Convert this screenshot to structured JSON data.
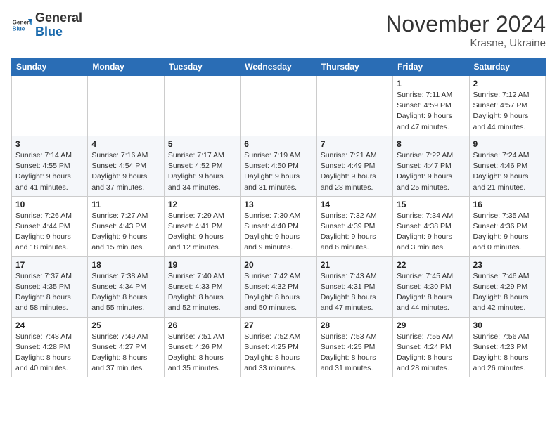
{
  "header": {
    "logo_general": "General",
    "logo_blue": "Blue",
    "month_title": "November 2024",
    "location": "Krasne, Ukraine"
  },
  "days_of_week": [
    "Sunday",
    "Monday",
    "Tuesday",
    "Wednesday",
    "Thursday",
    "Friday",
    "Saturday"
  ],
  "weeks": [
    [
      {
        "day": "",
        "sunrise": "",
        "sunset": "",
        "daylight": ""
      },
      {
        "day": "",
        "sunrise": "",
        "sunset": "",
        "daylight": ""
      },
      {
        "day": "",
        "sunrise": "",
        "sunset": "",
        "daylight": ""
      },
      {
        "day": "",
        "sunrise": "",
        "sunset": "",
        "daylight": ""
      },
      {
        "day": "",
        "sunrise": "",
        "sunset": "",
        "daylight": ""
      },
      {
        "day": "1",
        "sunrise": "Sunrise: 7:11 AM",
        "sunset": "Sunset: 4:59 PM",
        "daylight": "Daylight: 9 hours and 47 minutes."
      },
      {
        "day": "2",
        "sunrise": "Sunrise: 7:12 AM",
        "sunset": "Sunset: 4:57 PM",
        "daylight": "Daylight: 9 hours and 44 minutes."
      }
    ],
    [
      {
        "day": "3",
        "sunrise": "Sunrise: 7:14 AM",
        "sunset": "Sunset: 4:55 PM",
        "daylight": "Daylight: 9 hours and 41 minutes."
      },
      {
        "day": "4",
        "sunrise": "Sunrise: 7:16 AM",
        "sunset": "Sunset: 4:54 PM",
        "daylight": "Daylight: 9 hours and 37 minutes."
      },
      {
        "day": "5",
        "sunrise": "Sunrise: 7:17 AM",
        "sunset": "Sunset: 4:52 PM",
        "daylight": "Daylight: 9 hours and 34 minutes."
      },
      {
        "day": "6",
        "sunrise": "Sunrise: 7:19 AM",
        "sunset": "Sunset: 4:50 PM",
        "daylight": "Daylight: 9 hours and 31 minutes."
      },
      {
        "day": "7",
        "sunrise": "Sunrise: 7:21 AM",
        "sunset": "Sunset: 4:49 PM",
        "daylight": "Daylight: 9 hours and 28 minutes."
      },
      {
        "day": "8",
        "sunrise": "Sunrise: 7:22 AM",
        "sunset": "Sunset: 4:47 PM",
        "daylight": "Daylight: 9 hours and 25 minutes."
      },
      {
        "day": "9",
        "sunrise": "Sunrise: 7:24 AM",
        "sunset": "Sunset: 4:46 PM",
        "daylight": "Daylight: 9 hours and 21 minutes."
      }
    ],
    [
      {
        "day": "10",
        "sunrise": "Sunrise: 7:26 AM",
        "sunset": "Sunset: 4:44 PM",
        "daylight": "Daylight: 9 hours and 18 minutes."
      },
      {
        "day": "11",
        "sunrise": "Sunrise: 7:27 AM",
        "sunset": "Sunset: 4:43 PM",
        "daylight": "Daylight: 9 hours and 15 minutes."
      },
      {
        "day": "12",
        "sunrise": "Sunrise: 7:29 AM",
        "sunset": "Sunset: 4:41 PM",
        "daylight": "Daylight: 9 hours and 12 minutes."
      },
      {
        "day": "13",
        "sunrise": "Sunrise: 7:30 AM",
        "sunset": "Sunset: 4:40 PM",
        "daylight": "Daylight: 9 hours and 9 minutes."
      },
      {
        "day": "14",
        "sunrise": "Sunrise: 7:32 AM",
        "sunset": "Sunset: 4:39 PM",
        "daylight": "Daylight: 9 hours and 6 minutes."
      },
      {
        "day": "15",
        "sunrise": "Sunrise: 7:34 AM",
        "sunset": "Sunset: 4:38 PM",
        "daylight": "Daylight: 9 hours and 3 minutes."
      },
      {
        "day": "16",
        "sunrise": "Sunrise: 7:35 AM",
        "sunset": "Sunset: 4:36 PM",
        "daylight": "Daylight: 9 hours and 0 minutes."
      }
    ],
    [
      {
        "day": "17",
        "sunrise": "Sunrise: 7:37 AM",
        "sunset": "Sunset: 4:35 PM",
        "daylight": "Daylight: 8 hours and 58 minutes."
      },
      {
        "day": "18",
        "sunrise": "Sunrise: 7:38 AM",
        "sunset": "Sunset: 4:34 PM",
        "daylight": "Daylight: 8 hours and 55 minutes."
      },
      {
        "day": "19",
        "sunrise": "Sunrise: 7:40 AM",
        "sunset": "Sunset: 4:33 PM",
        "daylight": "Daylight: 8 hours and 52 minutes."
      },
      {
        "day": "20",
        "sunrise": "Sunrise: 7:42 AM",
        "sunset": "Sunset: 4:32 PM",
        "daylight": "Daylight: 8 hours and 50 minutes."
      },
      {
        "day": "21",
        "sunrise": "Sunrise: 7:43 AM",
        "sunset": "Sunset: 4:31 PM",
        "daylight": "Daylight: 8 hours and 47 minutes."
      },
      {
        "day": "22",
        "sunrise": "Sunrise: 7:45 AM",
        "sunset": "Sunset: 4:30 PM",
        "daylight": "Daylight: 8 hours and 44 minutes."
      },
      {
        "day": "23",
        "sunrise": "Sunrise: 7:46 AM",
        "sunset": "Sunset: 4:29 PM",
        "daylight": "Daylight: 8 hours and 42 minutes."
      }
    ],
    [
      {
        "day": "24",
        "sunrise": "Sunrise: 7:48 AM",
        "sunset": "Sunset: 4:28 PM",
        "daylight": "Daylight: 8 hours and 40 minutes."
      },
      {
        "day": "25",
        "sunrise": "Sunrise: 7:49 AM",
        "sunset": "Sunset: 4:27 PM",
        "daylight": "Daylight: 8 hours and 37 minutes."
      },
      {
        "day": "26",
        "sunrise": "Sunrise: 7:51 AM",
        "sunset": "Sunset: 4:26 PM",
        "daylight": "Daylight: 8 hours and 35 minutes."
      },
      {
        "day": "27",
        "sunrise": "Sunrise: 7:52 AM",
        "sunset": "Sunset: 4:25 PM",
        "daylight": "Daylight: 8 hours and 33 minutes."
      },
      {
        "day": "28",
        "sunrise": "Sunrise: 7:53 AM",
        "sunset": "Sunset: 4:25 PM",
        "daylight": "Daylight: 8 hours and 31 minutes."
      },
      {
        "day": "29",
        "sunrise": "Sunrise: 7:55 AM",
        "sunset": "Sunset: 4:24 PM",
        "daylight": "Daylight: 8 hours and 28 minutes."
      },
      {
        "day": "30",
        "sunrise": "Sunrise: 7:56 AM",
        "sunset": "Sunset: 4:23 PM",
        "daylight": "Daylight: 8 hours and 26 minutes."
      }
    ]
  ]
}
